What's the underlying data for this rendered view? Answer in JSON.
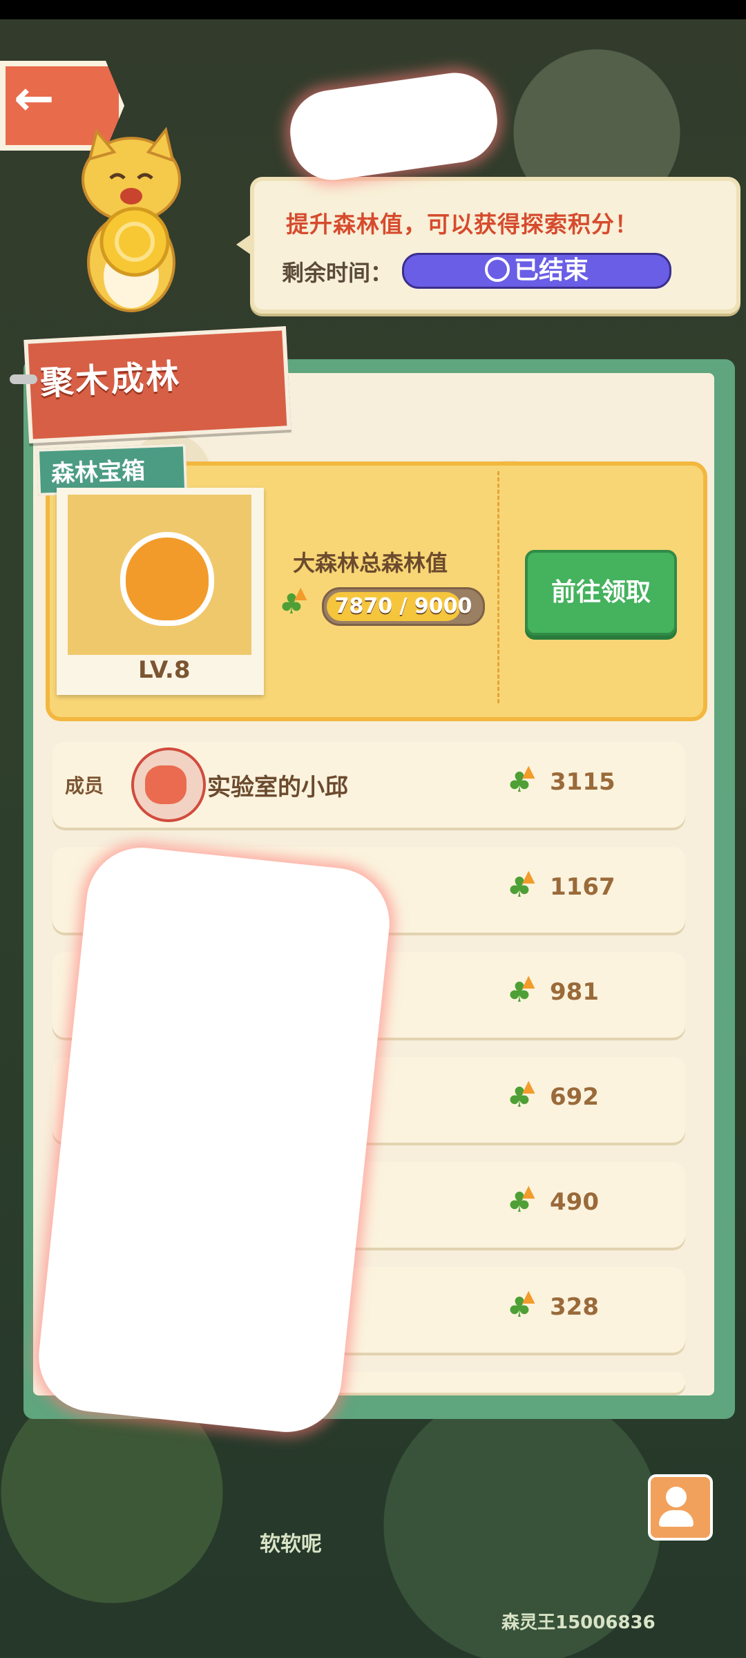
{
  "header": {
    "back_label": "",
    "bubble_message": "提升森林值，可以获得探索积分！",
    "time_label": "剩余时间：",
    "timer_status": "已结束"
  },
  "panel": {
    "title": "聚木成林",
    "chest_tag": "森林宝箱",
    "chest_level": "LV.8",
    "forest_value_title": "大森林总森林值",
    "progress_current": 7870,
    "progress_max": 9000,
    "progress_text": "7870 / 9000",
    "claim_button": "前往领取"
  },
  "members": {
    "label": "成员",
    "rows": [
      {
        "name": "实验室的小邱",
        "score": "3115"
      },
      {
        "name": "",
        "score": "1167"
      },
      {
        "name": "",
        "score": "981"
      },
      {
        "name": "",
        "score": "692"
      },
      {
        "name": "",
        "score": "490"
      },
      {
        "name": "",
        "score": "328"
      }
    ]
  },
  "map": {
    "labels": [
      "软软呢",
      "森灵王15006836"
    ]
  },
  "colors": {
    "accent_red": "#d75f45",
    "panel_green": "#5fa57e",
    "claim_green": "#45b25e",
    "timer_purple": "#6a5ee6"
  },
  "icons": [
    "back-arrow-icon",
    "clock-icon",
    "clover-icon",
    "profile-icon"
  ]
}
